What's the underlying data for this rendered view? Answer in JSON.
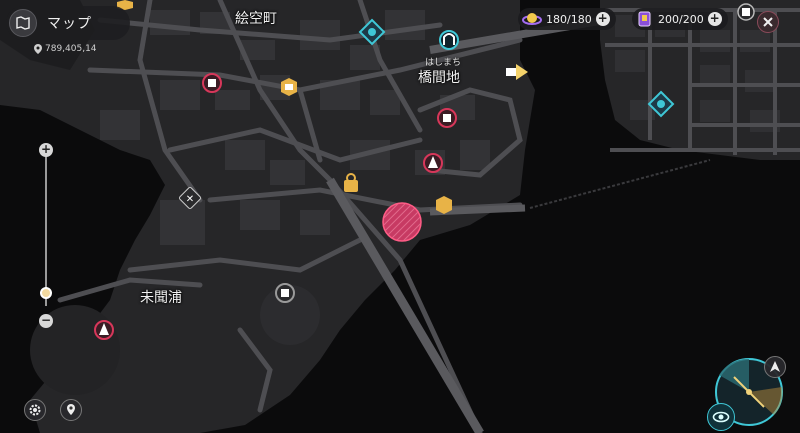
{
  "header": {
    "title": "マップ",
    "coordinates": "789,405,14"
  },
  "resources": {
    "stamina_value": "180/180",
    "cards_value": "200/200"
  },
  "places": {
    "ekuucho": "絵空町",
    "hashimachi_kana": "はしまち",
    "hashimachi": "橋間地",
    "mimaura": "未聞浦"
  },
  "icons": {
    "back": "map-fold-icon",
    "pin": "location-pin-icon",
    "gear": "gear-icon",
    "locate": "locate-icon",
    "close": "close-icon",
    "bell": "notification-icon",
    "compass": "compass-icon"
  },
  "zoom": {
    "level": 0.05
  },
  "colors": {
    "accent_cyan": "#3fc7d6",
    "marker_red": "#d7375a",
    "marker_gold": "#e8b347",
    "water": "#0b0b0c",
    "land": "#262628",
    "road": "#4e4e52"
  }
}
